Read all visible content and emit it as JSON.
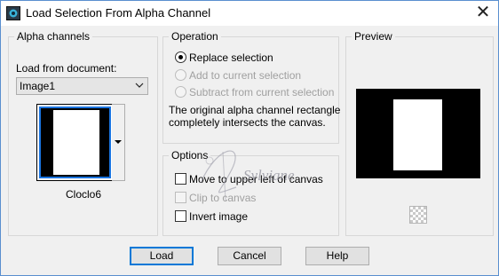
{
  "window": {
    "title": "Load Selection From Alpha Channel",
    "close_symbol": "✕"
  },
  "alpha_channels": {
    "legend": "Alpha channels",
    "load_from_label": "Load from document:",
    "document_select": {
      "value": "Image1"
    },
    "channel_name": "Cloclo6"
  },
  "operation": {
    "legend": "Operation",
    "options": [
      {
        "label": "Replace selection",
        "selected": true,
        "enabled": true
      },
      {
        "label": "Add to current selection",
        "selected": false,
        "enabled": false
      },
      {
        "label": "Subtract from current selection",
        "selected": false,
        "enabled": false
      }
    ],
    "message_line1": "The original alpha channel rectangle",
    "message_line2": "completely intersects the canvas."
  },
  "options": {
    "legend": "Options",
    "checkboxes": [
      {
        "label": "Move to upper left of canvas",
        "checked": false,
        "enabled": true
      },
      {
        "label": "Clip to canvas",
        "checked": false,
        "enabled": false
      },
      {
        "label": "Invert image",
        "checked": false,
        "enabled": true
      }
    ]
  },
  "preview": {
    "legend": "Preview"
  },
  "buttons": {
    "load": "Load",
    "cancel": "Cancel",
    "help": "Help"
  },
  "watermark_text": "Sylviane",
  "colors": {
    "accent_blue": "#0078d7",
    "window_border": "#5a8fcf",
    "disabled_text": "#a0a0a0"
  }
}
